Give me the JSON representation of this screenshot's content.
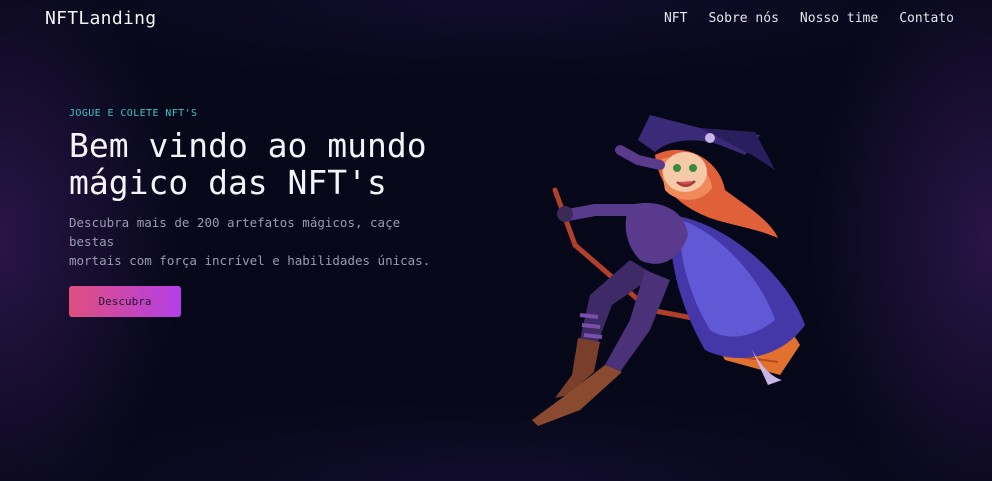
{
  "header": {
    "logo": "NFTLanding",
    "nav": [
      "NFT",
      "Sobre nós",
      "Nosso time",
      "Contato"
    ]
  },
  "hero": {
    "eyebrow": "JOGUE E COLETE NFT'S",
    "title_line1": "Bem vindo ao mundo",
    "title_line2": "mágico das NFT's",
    "description_line1": "Descubra mais de 200 artefatos mágicos, caçe bestas",
    "description_line2": "mortais com força incrível e habilidades únicas.",
    "cta_label": "Descubra",
    "illustration": "witch-on-broom"
  },
  "colors": {
    "background": "#060819",
    "accent_teal": "#39c6c8",
    "cta_gradient_start": "#e04f7e",
    "cta_gradient_end": "#b33fe8"
  }
}
